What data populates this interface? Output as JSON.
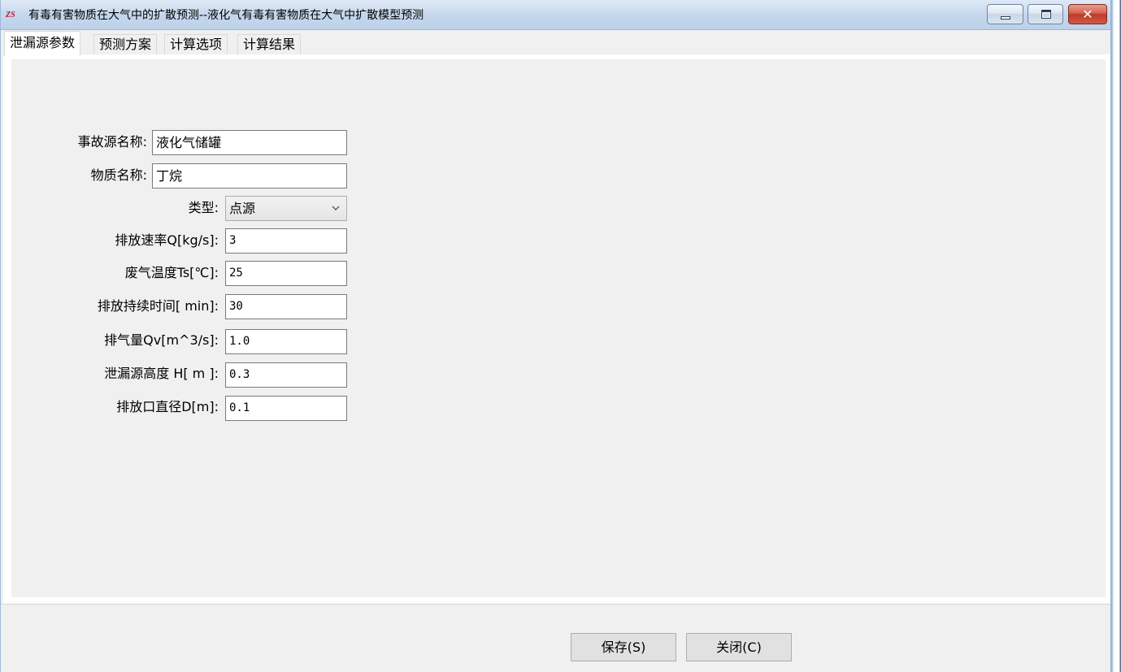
{
  "window": {
    "title": "有毒有害物质在大气中的扩散预测--液化气有毒有害物质在大气中扩散模型预测",
    "app_icon": "ZS",
    "controls": {
      "minimize": "minimize-icon",
      "maximize": "maximize-icon",
      "close": "✕"
    }
  },
  "tabs": [
    {
      "label": "泄漏源参数",
      "active": true
    },
    {
      "label": "预测方案",
      "active": false
    },
    {
      "label": "计算选项",
      "active": false
    },
    {
      "label": "计算结果",
      "active": false
    }
  ],
  "form": {
    "accident_source": {
      "label": "事故源名称:",
      "value": "液化气储罐"
    },
    "substance": {
      "label": "物质名称:",
      "value": "丁烷"
    },
    "type": {
      "label": "类型:",
      "value": "点源"
    },
    "emission_rate": {
      "label": "排放速率Q[kg/s]:",
      "value": "3"
    },
    "gas_temperature": {
      "label": "废气温度Ts[℃]:",
      "value": "25"
    },
    "duration": {
      "label": "排放持续时间[ min]:",
      "value": "30"
    },
    "gas_volume": {
      "label": "排气量Qv[m^3/s]:",
      "value": "1.0"
    },
    "source_height": {
      "label": "泄漏源高度 H[  m ]:",
      "value": "0.3"
    },
    "outlet_diameter": {
      "label": "排放口直径D[m]:",
      "value": "0.1"
    }
  },
  "buttons": {
    "save": "保存(S)",
    "close": "关闭(C)"
  }
}
